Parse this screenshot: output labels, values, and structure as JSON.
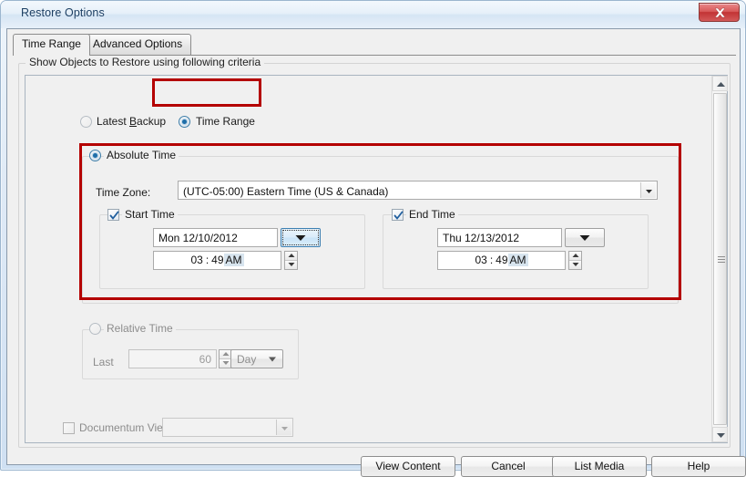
{
  "window": {
    "title": "Restore Options",
    "close_icon": "close-icon"
  },
  "tabs": [
    {
      "label": "Time Range",
      "active": true
    },
    {
      "label": "Advanced Options",
      "active": false
    }
  ],
  "group": {
    "legend": "Show Objects to Restore using following criteria"
  },
  "criteria": {
    "latest_backup": {
      "label": "Latest Backup",
      "selected": false
    },
    "time_range": {
      "label": "Time Range",
      "selected": true
    }
  },
  "absolute_time": {
    "label": "Absolute Time",
    "selected": true,
    "time_zone_label": "Time Zone:",
    "time_zone_value": "(UTC-05:00) Eastern Time (US & Canada)",
    "start_time": {
      "label": "Start Time",
      "checked": true,
      "date_value": "Mon 12/10/2012",
      "time_hour": "03",
      "time_separator": ":",
      "time_minute": "49",
      "time_meridiem": "AM",
      "dropdown_icon": "chevron-down-icon",
      "spinner_up_icon": "spinner-up-icon",
      "spinner_down_icon": "spinner-down-icon"
    },
    "end_time": {
      "label": "End Time",
      "checked": true,
      "date_value": "Thu 12/13/2012",
      "time_hour": "03",
      "time_separator": ":",
      "time_minute": "49",
      "time_meridiem": "AM",
      "dropdown_icon": "chevron-down-icon",
      "spinner_up_icon": "spinner-up-icon",
      "spinner_down_icon": "spinner-down-icon"
    }
  },
  "relative_time": {
    "label": "Relative Time",
    "selected": false,
    "last_label": "Last",
    "amount_value": "60",
    "unit_value": "Day"
  },
  "documentum": {
    "label": "Documentum View",
    "checked": false,
    "view_value": ""
  },
  "scrollbar": {
    "up_icon": "scroll-up-icon",
    "down_icon": "scroll-down-icon",
    "grip_icon": "grip-icon"
  },
  "buttons": [
    {
      "label": "View Content"
    },
    {
      "label": "Cancel"
    },
    {
      "label": "List Media"
    },
    {
      "label": "Help"
    }
  ],
  "colors": {
    "annotation": "#b40000",
    "accent": "#1f6ea8",
    "close": "#c23334"
  }
}
